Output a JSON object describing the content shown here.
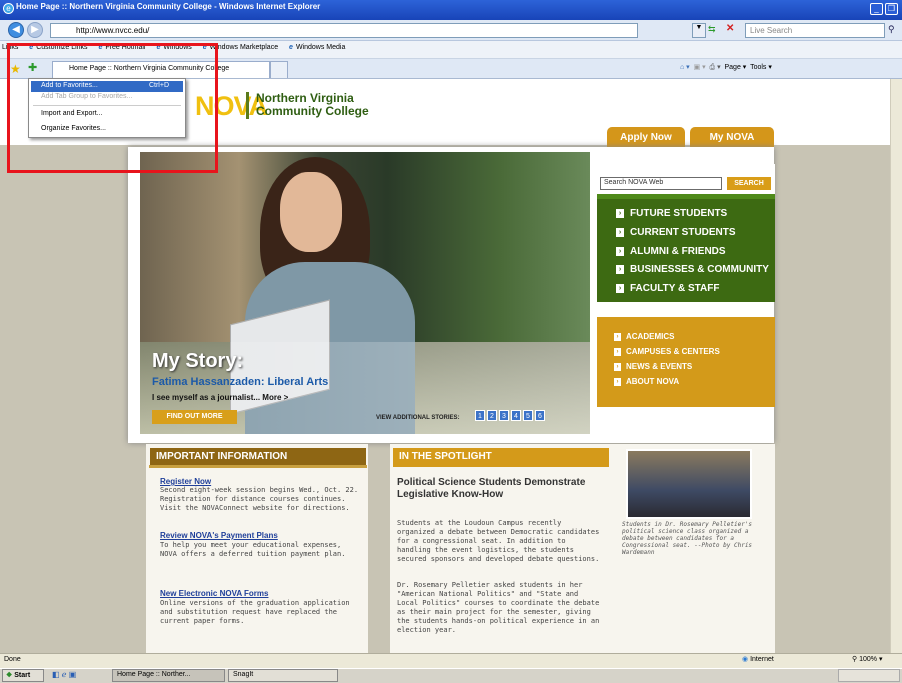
{
  "window": {
    "title": "Home Page :: Northern Virginia Community College - Windows Internet Explorer"
  },
  "toolbar": {
    "address": "http://www.nvcc.edu/",
    "search_placeholder": "Live Search",
    "links_label": "Links",
    "links": [
      "Customize Links",
      "Free Hotmail",
      "Windows",
      "Windows Marketplace",
      "Windows Media"
    ],
    "tab_title": "Home Page :: Northern Virginia Community College",
    "commands": [
      "Page",
      "Tools"
    ]
  },
  "favorites_menu": {
    "add": "Add to Favorites...",
    "add_shortcut": "Ctrl+D",
    "add_group": "Add Tab Group to Favorites...",
    "import_export": "Import and Export...",
    "organize": "Organize Favorites..."
  },
  "site": {
    "logo": "NOVA",
    "name_line1": "Northern Virginia",
    "name_line2": "Community College",
    "top_tabs": [
      "Apply Now",
      "My NOVA"
    ],
    "hero": {
      "heading": "My Story:",
      "name": "Fatima Hassanzaden: Liberal Arts",
      "tagline": "I see myself as a journalist...  More >",
      "button": "FIND OUT MORE",
      "view_more": "VIEW ADDITIONAL STORIES:",
      "stories": [
        "1",
        "2",
        "3",
        "4",
        "5",
        "6"
      ]
    },
    "search": {
      "placeholder": "Search NOVA Web",
      "button": "SEARCH"
    },
    "green_nav": [
      "FUTURE STUDENTS",
      "CURRENT STUDENTS",
      "ALUMNI & FRIENDS",
      "BUSINESSES & COMMUNITY",
      "FACULTY & STAFF"
    ],
    "gold_nav": [
      "ACADEMICS",
      "CAMPUSES & CENTERS",
      "NEWS & EVENTS",
      "ABOUT NOVA"
    ],
    "important": {
      "title": "IMPORTANT INFORMATION",
      "items": [
        {
          "title": "Register Now",
          "body": "Second eight-week session begins Wed., Oct. 22. Registration for distance courses continues. Visit the NOVAConnect website for directions."
        },
        {
          "title": "Review NOVA's Payment Plans",
          "body": "To help you meet your educational expenses, NOVA offers a deferred tuition payment plan."
        },
        {
          "title": "New Electronic NOVA Forms",
          "body": "Online versions of the graduation application and substitution request have replaced the current paper forms."
        }
      ]
    },
    "spotlight": {
      "title": "IN THE SPOTLIGHT",
      "headline": "Political Science Students Demonstrate Legislative Know-How",
      "para1": "Students at the Loudoun Campus recently organized a debate between Democratic candidates for a congressional seat. In addition to handling the event logistics, the students secured sponsors and developed debate questions.",
      "para2": "Dr. Rosemary Pelletier asked students in her \"American National Politics\" and \"State and Local Politics\" courses to coordinate the debate as their main project for the semester, giving the students hands-on political experience in an election year.",
      "caption": "Students in Dr. Rosemary Pelletier's political science class organized a debate between candidates for a Congressional seat. --Photo by Chris Wardemann"
    }
  },
  "status": {
    "text": "Done",
    "zone": "Internet",
    "zoom": "100%"
  },
  "taskbar": {
    "start": "Start",
    "tasks": [
      "Home Page :: Norther...",
      "SnagIt"
    ]
  },
  "colors": {
    "highlight": "#e8141c",
    "nova_green": "#3d6a12",
    "nova_gold": "#d39a1a"
  }
}
